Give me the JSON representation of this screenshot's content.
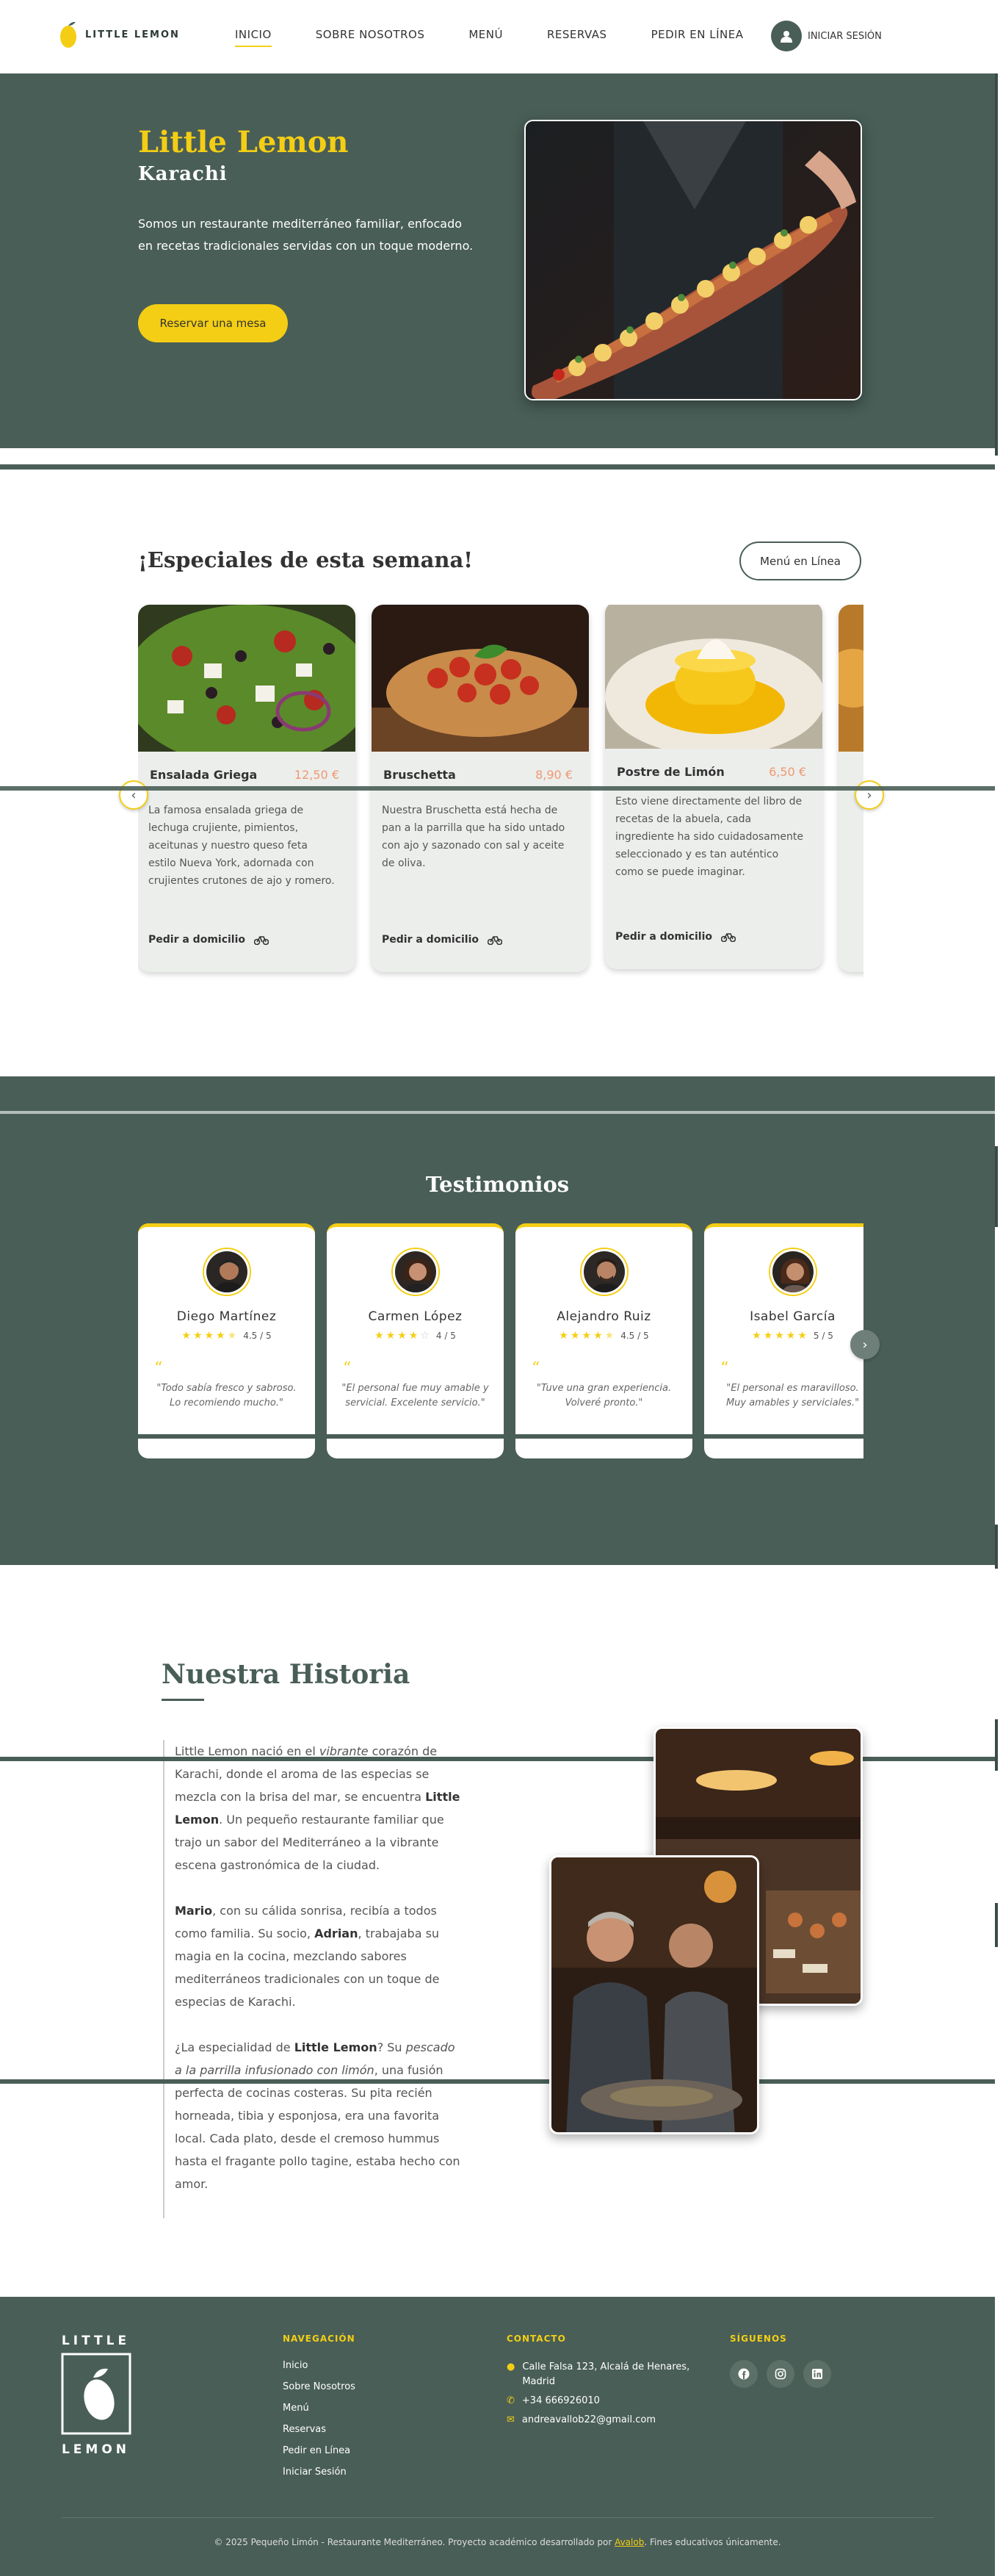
{
  "colors": {
    "primary": "#495e57",
    "accent": "#f4ce14",
    "price": "#ee9972"
  },
  "header": {
    "logo_text": "LITTLE LEMON",
    "nav": [
      "INICIO",
      "SOBRE NOSOTROS",
      "MENÚ",
      "RESERVAS",
      "PEDIR EN LÍNEA"
    ],
    "login_label": "INICIAR SESIÓN"
  },
  "hero": {
    "title": "Little Lemon",
    "subtitle": "Karachi",
    "description": "Somos un restaurante mediterráneo familiar, enfocado en recetas tradicionales servidas con un toque moderno.",
    "cta": "Reservar una mesa"
  },
  "specials": {
    "title": "¡Especiales de esta semana!",
    "menu_button": "Menú en Línea",
    "delivery_label": "Pedir a domicilio",
    "items": [
      {
        "name": "Ensalada Griega",
        "price": "12,50 €",
        "description": "La famosa ensalada griega de lechuga crujiente, pimientos, aceitunas y nuestro queso feta estilo Nueva York, adornada con crujientes crutones de ajo y romero."
      },
      {
        "name": "Bruschetta",
        "price": "8,90 €",
        "description": "Nuestra Bruschetta está hecha de pan a la parrilla que ha sido untado con ajo y sazonado con sal y aceite de oliva."
      },
      {
        "name": "Postre de Limón",
        "price": "6,50 €",
        "description": "Esto viene directamente del libro de recetas de la abuela, cada ingrediente ha sido cuidadosamente seleccionado y es tan auténtico como se puede imaginar."
      }
    ]
  },
  "testimonials": {
    "title": "Testimonios",
    "items": [
      {
        "name": "Diego Martínez",
        "rating": 4.5,
        "score": "4.5 / 5",
        "quote": "\"Todo sabía fresco y sabroso. Lo recomiendo mucho.\""
      },
      {
        "name": "Carmen López",
        "rating": 4,
        "score": "4 / 5",
        "quote": "\"El personal fue muy amable y servicial. Excelente servicio.\""
      },
      {
        "name": "Alejandro Ruiz",
        "rating": 4.5,
        "score": "4.5 / 5",
        "quote": "\"Tuve una gran experiencia. Volveré pronto.\""
      },
      {
        "name": "Isabel García",
        "rating": 5,
        "score": "5 / 5",
        "quote": "\"El personal es maravilloso. Muy amables y serviciales.\""
      }
    ]
  },
  "history": {
    "title": "Nuestra Historia",
    "p1_a": "Little Lemon nació en el ",
    "p1_em": "vibrante",
    "p1_b": " corazón de Karachi, donde el aroma de las especias se mezcla con la brisa del mar, se encuentra ",
    "p1_strong": "Little Lemon",
    "p1_c": ". Un pequeño restaurante familiar que trajo un sabor del Mediterráneo a la vibrante escena gastronómica de la ciudad.",
    "p2_strong1": "Mario",
    "p2_a": ", con su cálida sonrisa, recibía a todos como familia. Su socio, ",
    "p2_strong2": "Adrian",
    "p2_b": ", trabajaba su magia en la cocina, mezclando sabores mediterráneos tradicionales con un toque de especias de Karachi.",
    "p3_a": "¿La especialidad de ",
    "p3_strong": "Little Lemon",
    "p3_b": "? Su ",
    "p3_em": "pescado a la parrilla infusionado con limón",
    "p3_c": ", una fusión perfecta de cocinas costeras. Su pita recién horneada, tibia y esponjosa, era una favorita local. Cada plato, desde el cremoso hummus hasta el fragante pollo tagine, estaba hecho con amor."
  },
  "footer": {
    "logo_top": "LITTLE",
    "logo_bottom": "LEMON",
    "nav_heading": "NAVEGACIÓN",
    "nav_links": [
      "Inicio",
      "Sobre Nosotros",
      "Menú",
      "Reservas",
      "Pedir en Línea",
      "Iniciar Sesión"
    ],
    "contact_heading": "CONTACTO",
    "address": "Calle Falsa 123, Alcalá de Henares, Madrid",
    "phone": "+34 666926010",
    "email": "andreavallob22@gmail.com",
    "social_heading": "SÍGUENOS",
    "social": [
      "facebook-icon",
      "instagram-icon",
      "linkedin-icon"
    ],
    "copy_a": "© 2025 Pequeño Limón - Restaurante Mediterráneo. Proyecto académico desarrollado por ",
    "copy_link": "Avalob",
    "copy_b": ". Fines educativos únicamente."
  }
}
